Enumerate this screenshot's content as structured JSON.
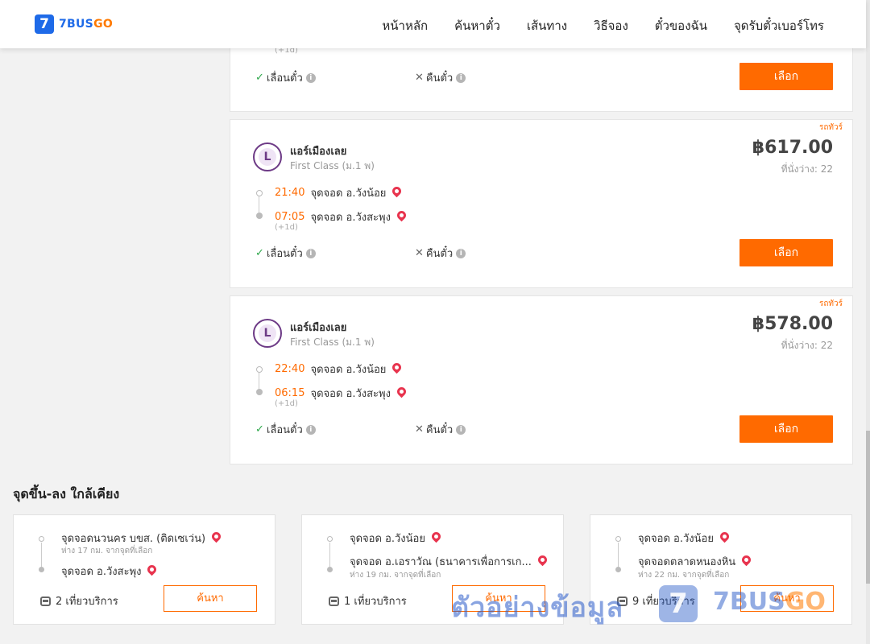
{
  "header": {
    "logo_mark": "7",
    "logo_brand": "7BUS",
    "logo_brand_go": "GO",
    "nav": [
      "หน้าหลัก",
      "ค้นหาตั๋ว",
      "เส้นทาง",
      "วิธีจอง",
      "ตั๋วของฉัน",
      "จุดรับตั๋วเบอร์โทร"
    ]
  },
  "partial_card": {
    "plus1d": "(+1d)",
    "reschedule_label": "เลื่อนตั๋ว",
    "refund_label": "คืนตั๋ว",
    "select_label": "เลือก"
  },
  "trips": [
    {
      "tag": "รถทัวร์",
      "logo_mark": "L",
      "operator": "แอร์เมืองเลย",
      "class": "First Class (ม.1 พ)",
      "price": "฿617.00",
      "seats": "ที่นั่งว่าง: 22",
      "depart_time": "21:40",
      "depart_stop": "จุดจอด อ.วังน้อย",
      "arrive_time": "07:05",
      "arrive_stop": "จุดจอด อ.วังสะพุง",
      "plus1d": "(+1d)",
      "reschedule_label": "เลื่อนตั๋ว",
      "refund_label": "คืนตั๋ว",
      "select_label": "เลือก"
    },
    {
      "tag": "รถทัวร์",
      "logo_mark": "L",
      "operator": "แอร์เมืองเลย",
      "class": "First Class (ม.1 พ)",
      "price": "฿578.00",
      "seats": "ที่นั่งว่าง: 22",
      "depart_time": "22:40",
      "depart_stop": "จุดจอด อ.วังน้อย",
      "arrive_time": "06:15",
      "arrive_stop": "จุดจอด อ.วังสะพุง",
      "plus1d": "(+1d)",
      "reschedule_label": "เลื่อนตั๋ว",
      "refund_label": "คืนตั๋ว",
      "select_label": "เลือก"
    }
  ],
  "nearby": {
    "title": "จุดขึ้น-ลง ใกล้เคียง",
    "cards": [
      {
        "from": "จุดจอดนวนคร บขส. (ติดเซเว่น)",
        "from_dist": "ห่าง 17 กม. จากจุดที่เลือก",
        "to": "จุดจอด อ.วังสะพุง",
        "to_dist": "",
        "service": "2 เที่ยวบริการ",
        "search_label": "ค้นหา"
      },
      {
        "from": "จุดจอด อ.วังน้อย",
        "from_dist": "",
        "to": "จุดจอด อ.เอราวัณ (ธนาคารเพื่อการเก...",
        "to_dist": "ห่าง 19 กม. จากจุดที่เลือก",
        "service": "1 เที่ยวบริการ",
        "search_label": "ค้นหา"
      },
      {
        "from": "จุดจอด อ.วังน้อย",
        "from_dist": "",
        "to": "จุดจอดตลาดหนองหิน",
        "to_dist": "ห่าง 22 กม. จากจุดที่เลือก",
        "service": "9 เที่ยวบริการ",
        "search_label": "ค้นหา"
      }
    ]
  },
  "watermark": {
    "text": "ตัวอย่างข้อมูล",
    "logo_mark": "7",
    "brand": "7BUS",
    "brand_go": "GO"
  },
  "colors": {
    "accent": "#ff6a00",
    "brand_blue": "#1e6ae8",
    "check_green": "#2ea84b",
    "pin_red": "#e8344e"
  }
}
